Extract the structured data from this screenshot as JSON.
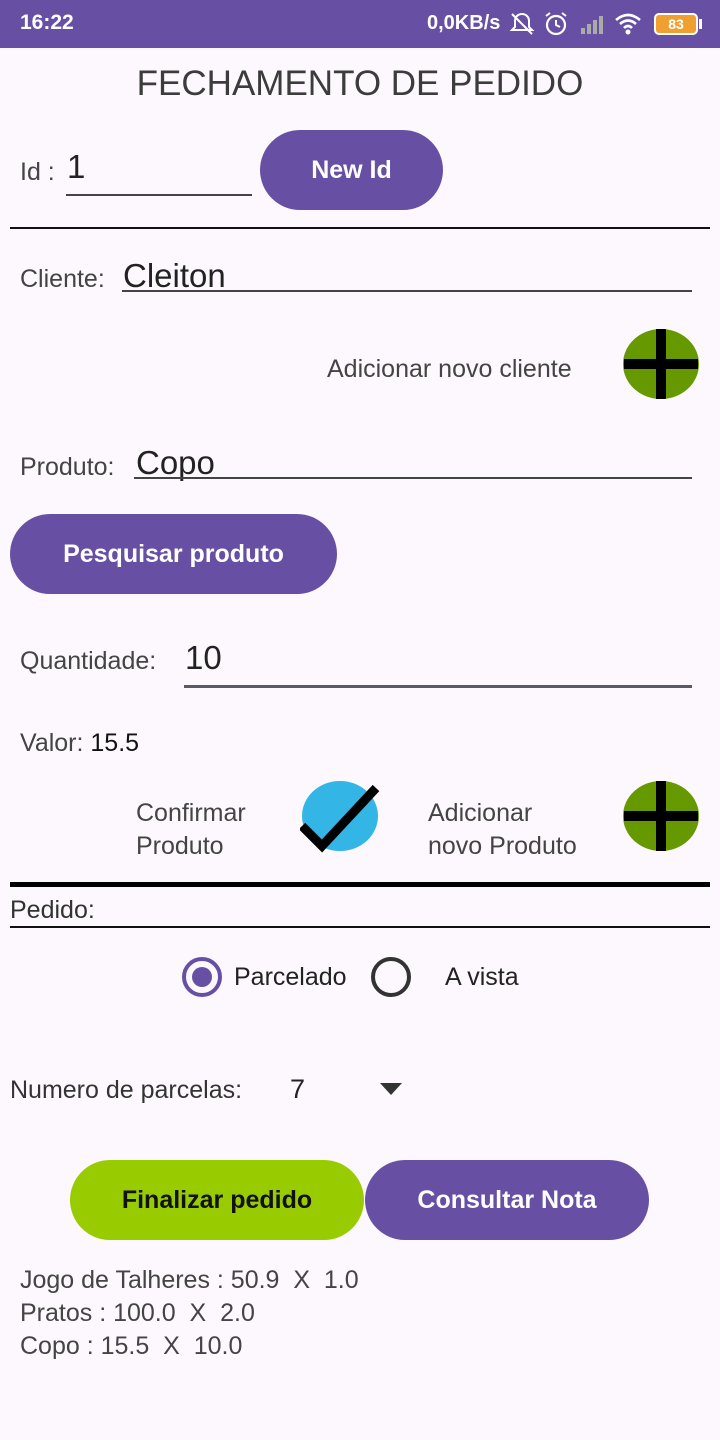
{
  "status_bar": {
    "time": "16:22",
    "speed": "0,0KB/s",
    "battery": "83"
  },
  "title": "FECHAMENTO DE PEDIDO",
  "id_field": {
    "label": "Id :",
    "value": "1"
  },
  "new_id_button": "New Id",
  "cliente": {
    "label": "Cliente:",
    "value": "Cleiton"
  },
  "add_cliente": {
    "label": "Adicionar novo cliente",
    "icon": "plus-icon",
    "icon_bg": "#669900"
  },
  "produto": {
    "label": "Produto:",
    "value": "Copo"
  },
  "search_product_button": "Pesquisar produto",
  "quantidade": {
    "label": "Quantidade:",
    "value": "10"
  },
  "valor": {
    "label": "Valor:",
    "value": "15.5"
  },
  "confirm_product": {
    "line1": "Confirmar",
    "line2": "Produto",
    "icon": "check-icon",
    "icon_bg": "#33b5e5"
  },
  "add_product": {
    "line1": "Adicionar",
    "line2": "novo Produto",
    "icon": "plus-icon",
    "icon_bg": "#669900"
  },
  "pedido_label": "Pedido:",
  "payment": {
    "options": [
      "Parcelado",
      "A vista"
    ],
    "selected": "Parcelado"
  },
  "parcelas": {
    "label": "Numero de parcelas:",
    "value": "7"
  },
  "finalizar_button": "Finalizar pedido",
  "consultar_button": "Consultar Nota",
  "items": [
    "Jogo de Talheres : 50.9  X  1.0",
    "Pratos : 100.0  X  2.0",
    "Copo : 15.5  X  10.0"
  ],
  "colors": {
    "accent": "#6750a4",
    "green_button": "#99cc00"
  }
}
